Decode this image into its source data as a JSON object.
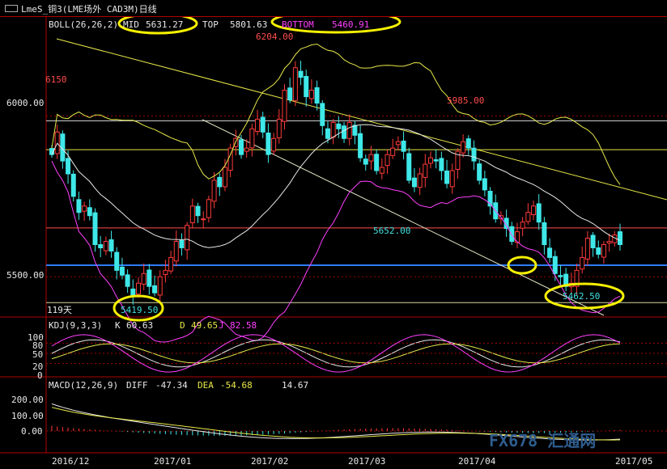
{
  "title": "LmeS_铜3(LME场外 CAD3M)日线",
  "boll": {
    "label": "BOLL(26,26,2)",
    "mid_label": "MID",
    "mid": "5631.27",
    "top_label": "TOP",
    "top": "5801.63",
    "bottom_label": "BOTTOM",
    "bottom": "5460.91"
  },
  "kdj": {
    "label": "KDJ(9,3,3)",
    "k_label": "K",
    "k": "60.63",
    "d_label": "D",
    "d": "49.65",
    "j_label": "J",
    "j": "82.58"
  },
  "macd": {
    "label": "MACD(12,26,9)",
    "diff_label": "DIFF",
    "diff": "-47.34",
    "dea_label": "DEA",
    "dea": "-54.68",
    "macd": "14.67"
  },
  "price_axis": [
    "6000.00",
    "5500.00"
  ],
  "kdj_axis": [
    "100",
    "80",
    "50",
    "20",
    "0"
  ],
  "macd_axis": [
    "200.00",
    "100.00",
    "0.00"
  ],
  "annotations": {
    "high": "6204.00",
    "p6150": "6150",
    "p5985": "5985.00",
    "p5652": "5652.00",
    "low1": "5419.50",
    "low2": "5462.50",
    "days": "119天"
  },
  "dates": [
    "2016/12",
    "2017/01",
    "2017/02",
    "2017/03",
    "2017/04",
    "2017/05"
  ],
  "watermark": "FX678 汇通网",
  "colors": {
    "up": "#ff3a3a",
    "down": "#3fe8e8",
    "mid": "#e8e8e8",
    "band": "#e8e84a",
    "bottom": "#ff40ff",
    "blue_line": "#2f7dff",
    "ellipse": "#f6f000"
  },
  "chart_data": {
    "type": "candlestick",
    "ylim": [
      5380,
      6260
    ],
    "x": [
      "2016-12-08",
      "2016-12-09",
      "2016-12-12",
      "2016-12-13",
      "2016-12-14",
      "2016-12-15",
      "2016-12-16",
      "2016-12-19",
      "2016-12-20",
      "2016-12-21",
      "2016-12-22",
      "2016-12-23",
      "2016-12-27",
      "2016-12-28",
      "2016-12-29",
      "2016-12-30",
      "2017-01-03",
      "2017-01-04",
      "2017-01-05",
      "2017-01-06",
      "2017-01-09",
      "2017-01-10",
      "2017-01-11",
      "2017-01-12",
      "2017-01-13",
      "2017-01-16",
      "2017-01-17",
      "2017-01-18",
      "2017-01-19",
      "2017-01-20",
      "2017-01-23",
      "2017-01-24",
      "2017-01-25",
      "2017-01-26",
      "2017-01-27",
      "2017-01-30",
      "2017-01-31",
      "2017-02-01",
      "2017-02-02",
      "2017-02-03",
      "2017-02-06",
      "2017-02-07",
      "2017-02-08",
      "2017-02-09",
      "2017-02-10",
      "2017-02-13",
      "2017-02-14",
      "2017-02-15",
      "2017-02-16",
      "2017-02-17",
      "2017-02-20",
      "2017-02-21",
      "2017-02-22",
      "2017-02-23",
      "2017-02-24",
      "2017-02-27",
      "2017-02-28",
      "2017-03-01",
      "2017-03-02",
      "2017-03-03",
      "2017-03-06",
      "2017-03-07",
      "2017-03-08",
      "2017-03-09",
      "2017-03-10",
      "2017-03-13",
      "2017-03-14",
      "2017-03-15",
      "2017-03-16",
      "2017-03-17",
      "2017-03-20",
      "2017-03-21",
      "2017-03-22",
      "2017-03-23",
      "2017-03-24",
      "2017-03-27",
      "2017-03-28",
      "2017-03-29",
      "2017-03-30",
      "2017-03-31",
      "2017-04-03",
      "2017-04-04",
      "2017-04-05",
      "2017-04-06",
      "2017-04-07",
      "2017-04-10",
      "2017-04-11",
      "2017-04-12",
      "2017-04-13",
      "2017-04-18",
      "2017-04-19",
      "2017-04-20",
      "2017-04-21",
      "2017-04-24",
      "2017-04-25",
      "2017-04-26",
      "2017-04-27",
      "2017-04-28",
      "2017-05-02",
      "2017-05-03",
      "2017-05-04",
      "2017-05-05",
      "2017-05-08",
      "2017-05-09",
      "2017-05-10",
      "2017-05-11"
    ],
    "close": [
      5880,
      5950,
      5860,
      5820,
      5750,
      5700,
      5720,
      5690,
      5600,
      5590,
      5610,
      5580,
      5520,
      5505,
      5470,
      5440,
      5480,
      5510,
      5470,
      5450,
      5500,
      5520,
      5560,
      5610,
      5590,
      5660,
      5720,
      5690,
      5680,
      5740,
      5800,
      5780,
      5840,
      5900,
      5930,
      5880,
      5900,
      5960,
      5990,
      5950,
      5880,
      5930,
      5990,
      6080,
      6050,
      6150,
      6120,
      6060,
      6080,
      6040,
      5970,
      5930,
      5980,
      5960,
      5930,
      5980,
      5940,
      5870,
      5850,
      5880,
      5830,
      5840,
      5880,
      5900,
      5920,
      5890,
      5800,
      5780,
      5820,
      5850,
      5870,
      5860,
      5830,
      5790,
      5830,
      5890,
      5920,
      5900,
      5860,
      5800,
      5770,
      5720,
      5680,
      5690,
      5650,
      5610,
      5640,
      5670,
      5700,
      5720,
      5670,
      5600,
      5560,
      5510,
      5500,
      5470,
      5480,
      5520,
      5560,
      5620,
      5590,
      5570,
      5600,
      5610,
      5630,
      5600
    ]
  }
}
